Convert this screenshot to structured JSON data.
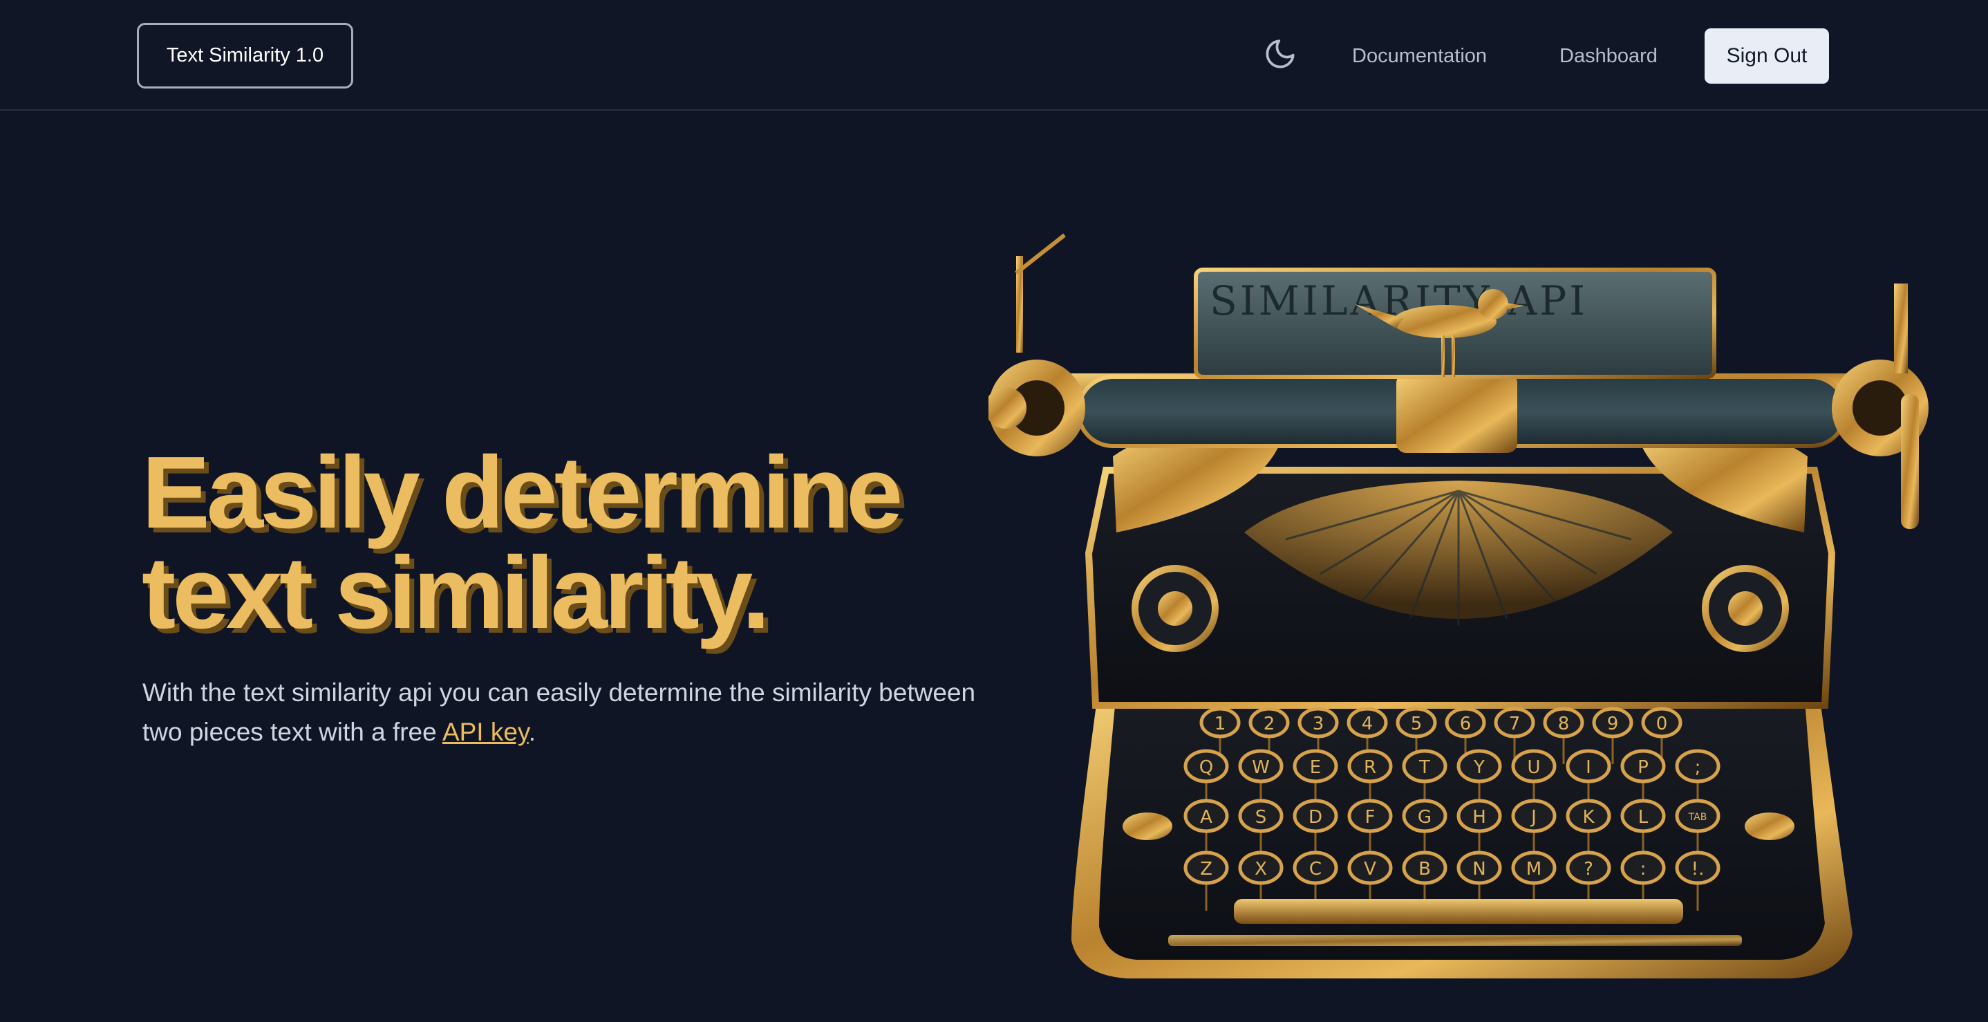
{
  "header": {
    "brand": "Text Similarity 1.0",
    "nav": [
      {
        "label": "Documentation"
      },
      {
        "label": "Dashboard"
      }
    ],
    "sign_out": "Sign Out",
    "theme_icon": "moon-icon"
  },
  "hero": {
    "title_line1": "Easily determine",
    "title_line2": "text similarity.",
    "desc_prefix": "With the text similarity api you can easily determine the similarity between two pieces text with a free ",
    "desc_link": "API key",
    "desc_suffix": "."
  },
  "illustration": {
    "paper_text": "SIMILARITY API",
    "keys_row_numbers": [
      "1",
      "2",
      "3",
      "4",
      "5",
      "6",
      "7",
      "8",
      "9",
      "0"
    ],
    "keys_row_top": [
      "Q",
      "W",
      "E",
      "R",
      "T",
      "Y",
      "U",
      "I",
      "P",
      ";"
    ],
    "keys_row_middle": [
      "A",
      "S",
      "D",
      "F",
      "G",
      "H",
      "J",
      "K",
      "L",
      "TAB"
    ],
    "keys_row_bottom": [
      "Z",
      "X",
      "C",
      "V",
      "B",
      "N",
      "M",
      "?",
      ":",
      "!."
    ]
  },
  "colors": {
    "background": "#0f1524",
    "accent_gold": "#ebbd60",
    "button_light": "#e8edf6"
  }
}
